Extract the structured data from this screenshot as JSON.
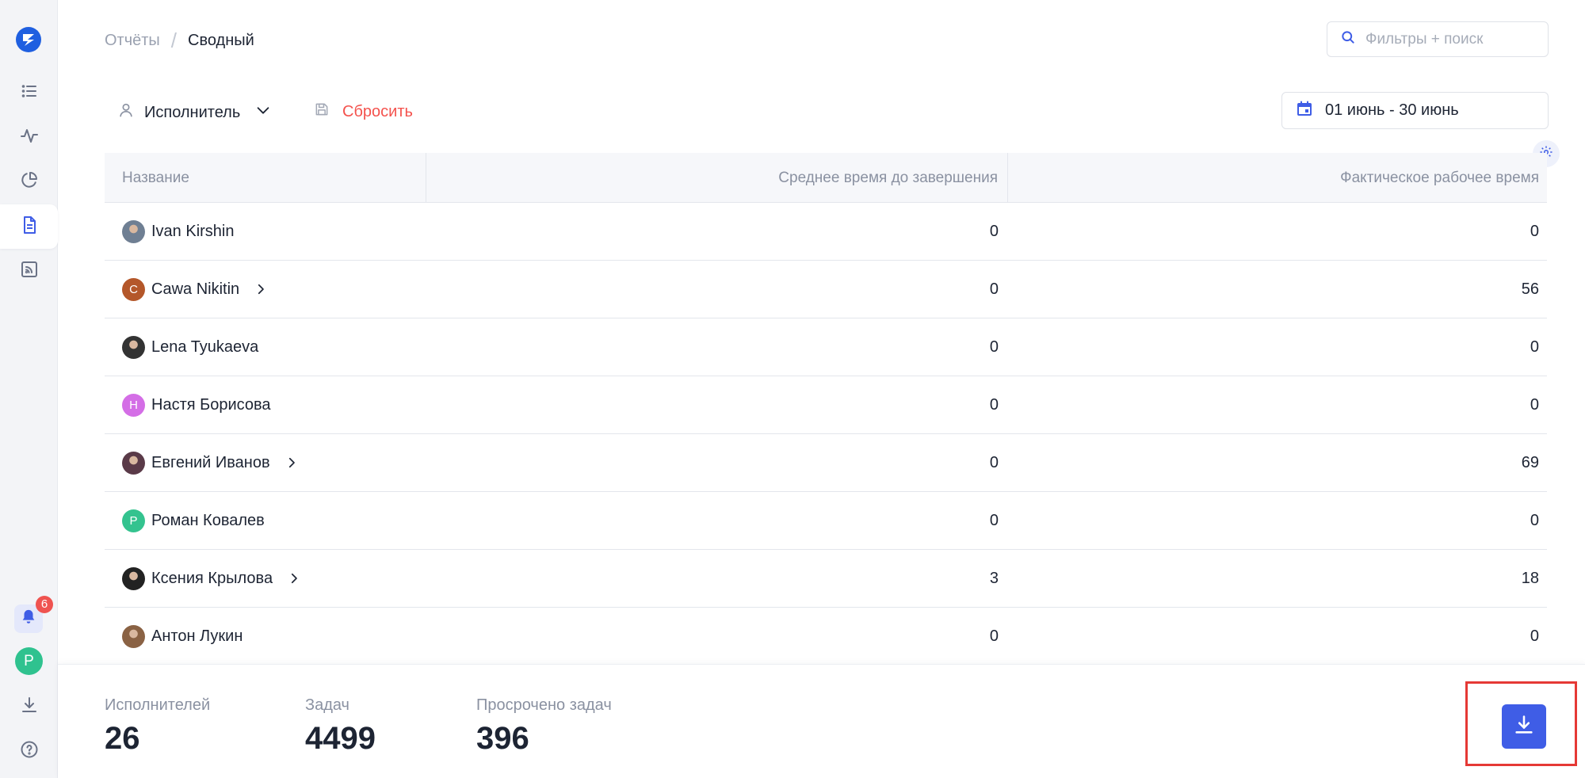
{
  "breadcrumb": {
    "parent": "Отчёты",
    "current": "Сводный"
  },
  "search": {
    "placeholder": "Фильтры + поиск"
  },
  "toolbar": {
    "group_by": "Исполнитель",
    "reset": "Сбросить",
    "date_range": "01 июнь - 30 июнь"
  },
  "sidebar": {
    "items": [
      {
        "icon": "list-icon"
      },
      {
        "icon": "activity-icon"
      },
      {
        "icon": "pie-chart-icon"
      },
      {
        "icon": "document-icon",
        "active": true
      },
      {
        "icon": "feed-icon"
      }
    ],
    "notifications_count": "6",
    "user_initial": "Р"
  },
  "table": {
    "columns": [
      "Название",
      "Среднее время до завершения",
      "Фактическое рабочее время"
    ],
    "rows": [
      {
        "name": "Ivan Kirshin",
        "avg": "0",
        "actual": "0",
        "avatar": "photo",
        "color": "#6f7f93",
        "expandable": false
      },
      {
        "name": "Cawa Nikitin",
        "avg": "0",
        "actual": "56",
        "avatar": "С",
        "color": "#b4572a",
        "expandable": true
      },
      {
        "name": "Lena Tyukaeva",
        "avg": "0",
        "actual": "0",
        "avatar": "photo",
        "color": "#333333",
        "expandable": false
      },
      {
        "name": "Настя Борисова",
        "avg": "0",
        "actual": "0",
        "avatar": "Н",
        "color": "#d46ee6",
        "expandable": false
      },
      {
        "name": "Евгений Иванов",
        "avg": "0",
        "actual": "69",
        "avatar": "photo",
        "color": "#5a3a48",
        "expandable": true
      },
      {
        "name": "Роман Ковалев",
        "avg": "0",
        "actual": "0",
        "avatar": "Р",
        "color": "#34c38f",
        "expandable": false
      },
      {
        "name": "Ксения Крылова",
        "avg": "3",
        "actual": "18",
        "avatar": "photo",
        "color": "#222222",
        "expandable": true
      },
      {
        "name": "Антон Лукин",
        "avg": "0",
        "actual": "0",
        "avatar": "photo",
        "color": "#8a6244",
        "expandable": false
      }
    ]
  },
  "stats": [
    {
      "label": "Исполнителей",
      "value": "26"
    },
    {
      "label": "Задач",
      "value": "4499"
    },
    {
      "label": "Просрочено задач",
      "value": "396"
    }
  ],
  "colors": {
    "accent": "#3f5de6",
    "danger": "#f4524d",
    "highlight": "#e53935"
  }
}
